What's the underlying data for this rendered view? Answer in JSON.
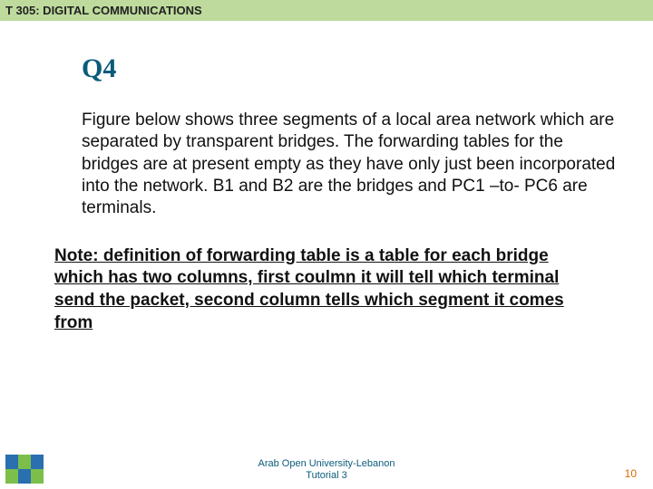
{
  "header": {
    "course_code": "T 305: DIGITAL COMMUNICATIONS"
  },
  "main": {
    "question_label": "Q4",
    "body": "Figure below shows three segments of a local area network which are separated by transparent bridges. The forwarding tables for the bridges are at present empty as they have only just been incorporated into the network. B1 and B2 are the bridges and PC1 –to- PC6 are terminals.",
    "note": "Note: definition of forwarding table is a table for each bridge which has two columns, first coulmn it will tell which terminal send the packet, second column tells which segment it comes from"
  },
  "footer": {
    "institution": "Arab Open University-Lebanon",
    "subtitle": "Tutorial 3",
    "page_number": "10"
  }
}
